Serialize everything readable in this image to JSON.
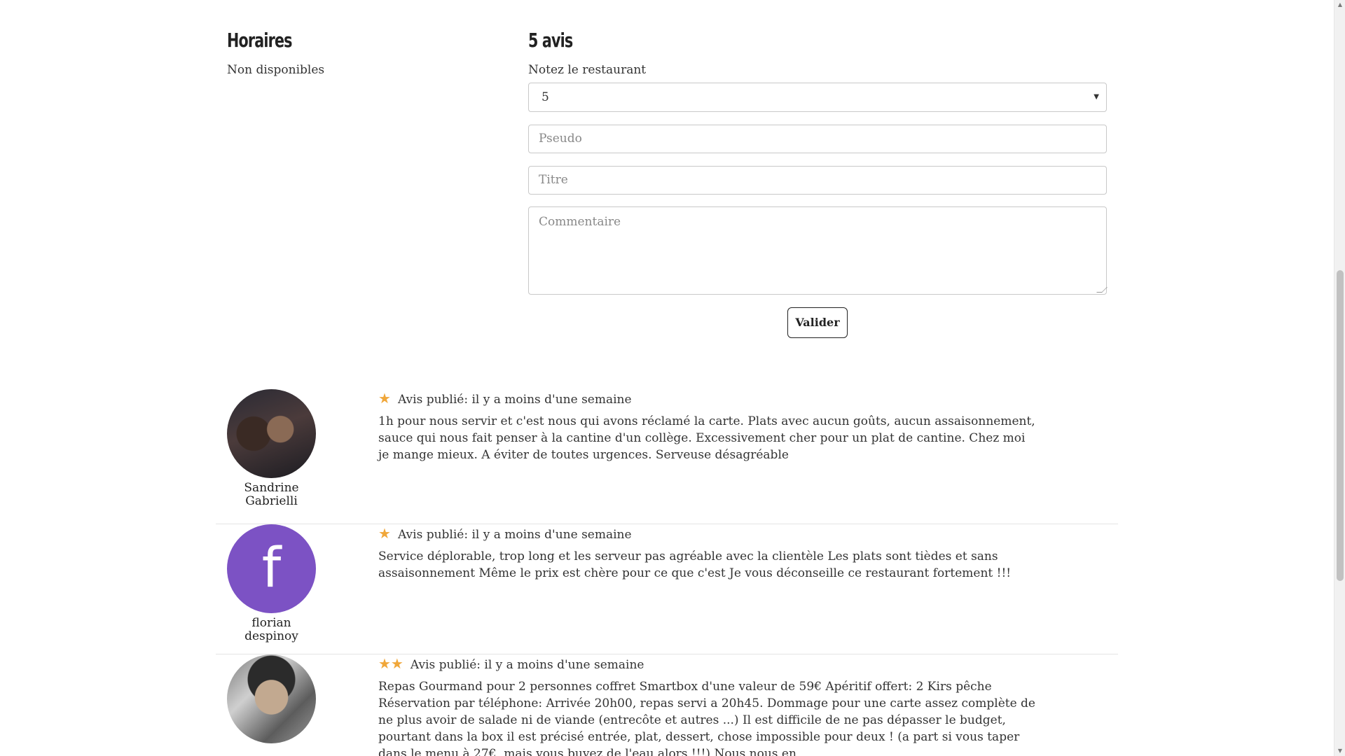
{
  "hours": {
    "title": "Horaires",
    "value": "Non disponibles"
  },
  "review_form": {
    "title": "5 avis",
    "rate_label": "Notez le restaurant",
    "rating_selected": "5",
    "pseudo_placeholder": "Pseudo",
    "title_placeholder": "Titre",
    "comment_placeholder": "Commentaire",
    "submit_label": "Valider"
  },
  "reviews": [
    {
      "author": "Sandrine Gabrielli",
      "stars": 1,
      "star_glyphs": "★",
      "meta": "Avis publié: il y a moins d'une semaine",
      "text": "1h pour nous servir et c'est nous qui avons réclamé la carte. Plats avec aucun goûts, aucun assaisonnement, sauce qui nous fait penser à la cantine d'un collège. Excessivement cher pour un plat de cantine. Chez moi je mange mieux. A éviter de toutes urgences. Serveuse désagréable"
    },
    {
      "author": "florian despinoy",
      "avatar_letter": "f",
      "stars": 1,
      "star_glyphs": "★",
      "meta": "Avis publié: il y a moins d'une semaine",
      "text": "Service déplorable, trop long et les serveur pas agréable avec la clientèle Les plats sont tièdes et sans assaisonnement Même le prix est chère pour ce que c'est Je vous déconseille ce restaurant fortement !!!"
    },
    {
      "author": "",
      "stars": 2,
      "star_glyphs": "★★",
      "meta": "Avis publié: il y a moins d'une semaine",
      "text": "Repas Gourmand pour 2 personnes coffret Smartbox d'une valeur de 59€ Apéritif offert: 2 Kirs pêche Réservation par téléphone: Arrivée 20h00, repas servi a 20h45. Dommage pour une carte assez complète de ne plus avoir de salade ni de viande (entrecôte et autres ...) Il est difficile de ne pas dépasser le budget, pourtant dans la box il est précisé entrée, plat, dessert, chose impossible pour deux ! (a part si vous taper dans le menu à 27€, mais vous buvez de l'eau alors !!!) Nous nous en"
    }
  ],
  "colors": {
    "star": "#f0a73a",
    "avatar_letter_bg": "#7c52c4",
    "divider": "#e4e4e4"
  }
}
